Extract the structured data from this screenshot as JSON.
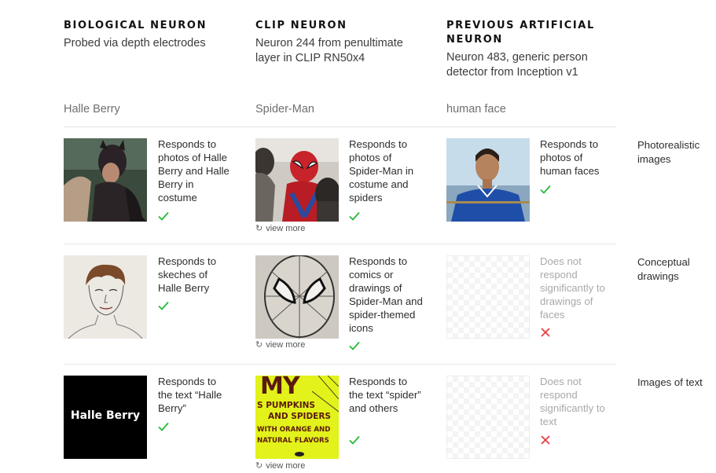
{
  "columns": [
    {
      "title": "BIOLOGICAL NEURON",
      "subtitle": "Probed via depth electrodes",
      "subject": "Halle Berry"
    },
    {
      "title": "CLIP NEURON",
      "subtitle": "Neuron 244 from penultimate layer in CLIP RN50x4",
      "subject": "Spider-Man"
    },
    {
      "title": "PREVIOUS ARTIFICIAL NEURON",
      "subtitle": "Neuron 483, generic person detector from Inception v1",
      "subject": "human face"
    }
  ],
  "rows": [
    {
      "label": "Photorealistic images",
      "cells": [
        {
          "desc": "Responds to photos of Halle Berry and Halle Berry in costume",
          "responds": true
        },
        {
          "desc": "Responds to photos of Spider-Man in costume and spiders",
          "responds": true,
          "more": "view more"
        },
        {
          "desc": "Responds to photos of human faces",
          "responds": true
        }
      ]
    },
    {
      "label": "Conceptual drawings",
      "cells": [
        {
          "desc": "Responds to skeches of Halle Berry",
          "responds": true
        },
        {
          "desc": "Responds to comics or drawings of Spider-Man and spider-themed icons",
          "responds": true,
          "more": "view more"
        },
        {
          "desc": "Does not respond significantly to drawings of faces",
          "responds": false
        }
      ]
    },
    {
      "label": "Images of text",
      "cells": [
        {
          "desc": "Responds to the text “Halle Berry”",
          "responds": true
        },
        {
          "desc": "Responds to the text “spider” and others",
          "responds": true,
          "more": "view more"
        },
        {
          "desc": "Does not respond significantly to text",
          "responds": false
        }
      ]
    }
  ],
  "image_text": {
    "halle_text": "Halle Berry",
    "poster_lines": [
      "MY",
      "S PUMPKINS",
      "AND SPIDERS",
      "WITH ORANGE AND",
      "NATURAL FLAVORS"
    ]
  },
  "colors": {
    "check": "#22bb33",
    "cross": "#e84040",
    "rule": "#e6e6e6",
    "muted": "#a9a9a9"
  },
  "icons": {
    "responds": "check-icon",
    "no_response": "cross-icon",
    "more": "refresh-icon"
  }
}
